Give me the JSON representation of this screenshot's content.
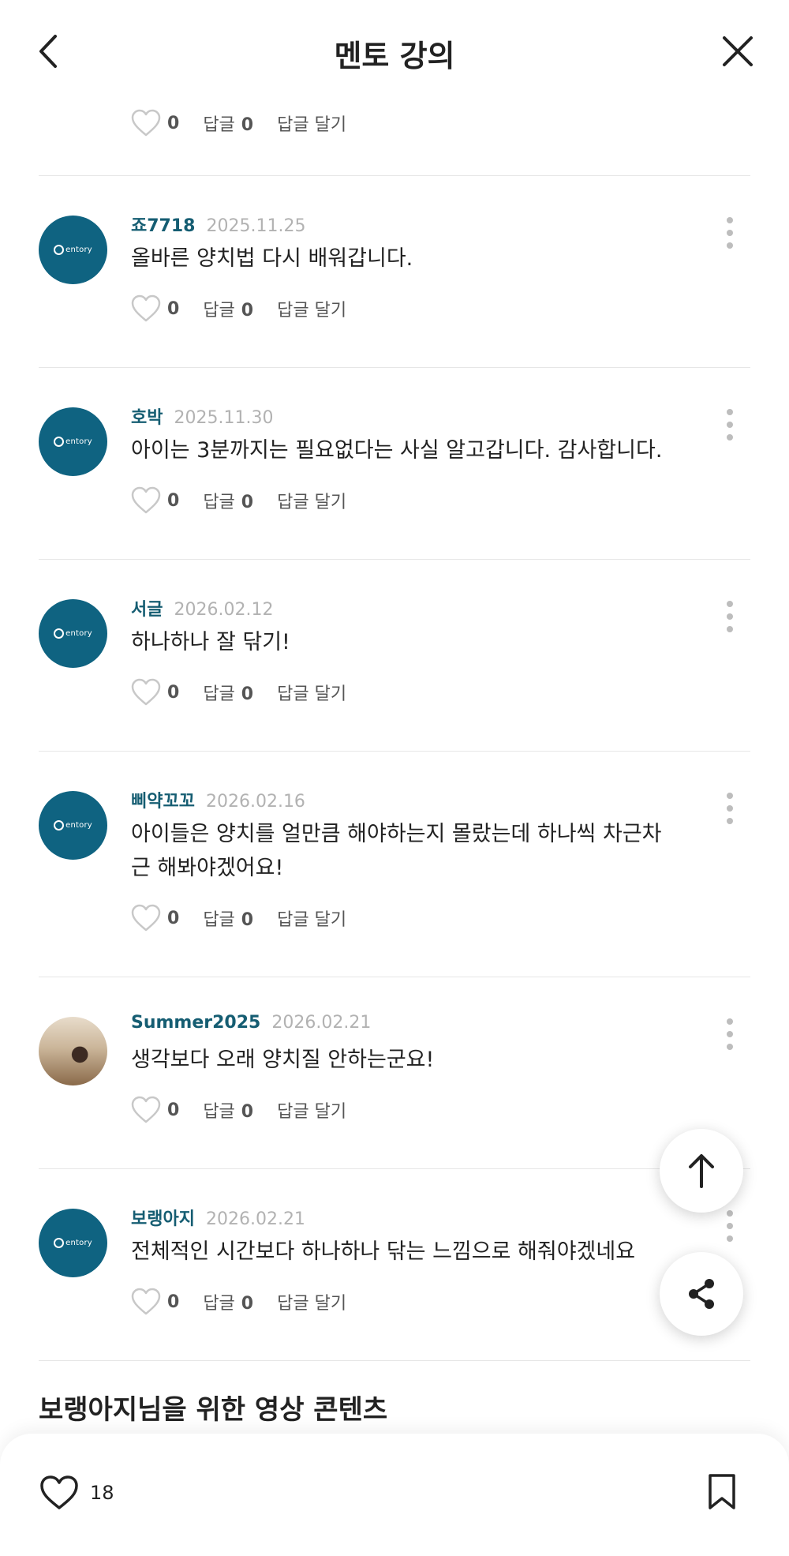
{
  "header": {
    "title": "멘토 강의"
  },
  "top_actions": {
    "likes": "0",
    "reply_label": "답글",
    "reply_count": "0",
    "write_reply": "답글 달기"
  },
  "comments": [
    {
      "nick": "죠7718",
      "date": "2025.11.25",
      "text": "올바른 양치법 다시 배워갑니다.",
      "likes": "0",
      "reply_label": "답글",
      "reply_count": "0",
      "write_reply": "답글 달기",
      "avatar": "brand"
    },
    {
      "nick": "호박",
      "date": "2025.11.30",
      "text": "아이는 3분까지는 필요없다는 사실 알고갑니다. 감사합니다.",
      "likes": "0",
      "reply_label": "답글",
      "reply_count": "0",
      "write_reply": "답글 달기",
      "avatar": "brand"
    },
    {
      "nick": "서글",
      "date": "2026.02.12",
      "text": "하나하나 잘 닦기!",
      "likes": "0",
      "reply_label": "답글",
      "reply_count": "0",
      "write_reply": "답글 달기",
      "avatar": "brand"
    },
    {
      "nick": "삐약꼬꼬",
      "date": "2026.02.16",
      "text": "아이들은 양치를 얼만큼 해야하는지 몰랐는데 하나씩 차근차근 해봐야겠어요!",
      "likes": "0",
      "reply_label": "답글",
      "reply_count": "0",
      "write_reply": "답글 달기",
      "avatar": "brand"
    },
    {
      "nick": "Summer2025",
      "date": "2026.02.21",
      "text": "생각보다 오래 양치질 안하는군요!",
      "likes": "0",
      "reply_label": "답글",
      "reply_count": "0",
      "write_reply": "답글 달기",
      "avatar": "photo"
    },
    {
      "nick": "보랭아지",
      "date": "2026.02.21",
      "text": "전체적인 시간보다 하나하나 닦는 느낌으로 해줘야겠네요",
      "likes": "0",
      "reply_label": "답글",
      "reply_count": "0",
      "write_reply": "답글 달기",
      "avatar": "brand"
    }
  ],
  "avatar_logo_text": "entory",
  "section_title": "보랭아지님을 위한 영상 콘텐츠",
  "bottom_bar": {
    "like_count": "18"
  },
  "colors": {
    "nickname": "#155d72",
    "brand_avatar": "#0f6381",
    "date": "#b2b2b2",
    "divider": "#e6e6e6"
  },
  "icons": [
    "back-arrow-icon",
    "close-icon",
    "heart-outline-icon",
    "kebab-menu-icon",
    "arrow-up-icon",
    "share-icon",
    "bookmark-icon"
  ]
}
